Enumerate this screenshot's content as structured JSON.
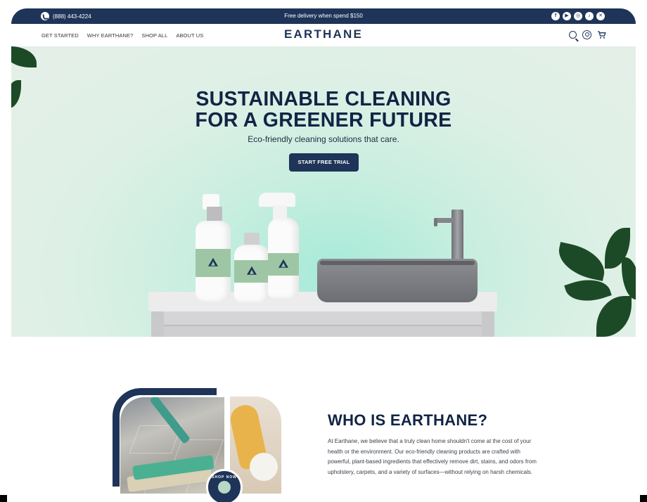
{
  "topbar": {
    "phone": "(888) 443-4224",
    "promo": "Free delivery when spend $150",
    "socials": [
      {
        "icon": "facebook-icon",
        "glyph": "f"
      },
      {
        "icon": "youtube-icon",
        "glyph": "▶"
      },
      {
        "icon": "instagram-icon",
        "glyph": "◎"
      },
      {
        "icon": "tiktok-icon",
        "glyph": "♪"
      },
      {
        "icon": "x-icon",
        "glyph": "✕"
      }
    ]
  },
  "nav": {
    "menu": [
      "GET STARTED",
      "WHY EARTHANE?",
      "SHOP ALL",
      "ABOUT US"
    ],
    "logo": "EARTHANE",
    "icons": [
      "search-icon",
      "account-icon",
      "cart-icon"
    ]
  },
  "hero": {
    "title_line1": "SUSTAINABLE CLEANING",
    "title_line2": "FOR A GREENER FUTURE",
    "subtitle": "Eco-friendly cleaning solutions that care.",
    "cta": "START FREE TRIAL"
  },
  "who": {
    "title": "WHO IS EARTHANE?",
    "body": "At Earthane, we believe that a truly clean home shouldn't come at the cost of your health or the environment. Our eco-friendly cleaning products are crafted with powerful, plant-based ingredients that effectively remove dirt, stains, and odors from upholstery, carpets, and a variety of surfaces—without relying on harsh chemicals.",
    "badge": "SHOP NOW"
  },
  "colors": {
    "brand_navy": "#1e3458",
    "label_green": "#9fc6a4"
  }
}
